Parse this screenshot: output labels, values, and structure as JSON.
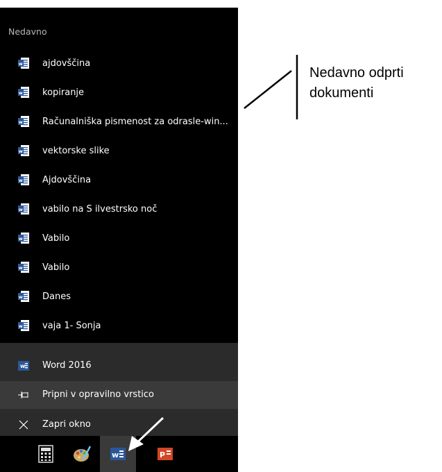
{
  "jumplist": {
    "section_title": "Nedavno",
    "recent": [
      "ajdovščina",
      "kopiranje",
      "Računalniška pismenost za odrasle-win...",
      "vektorske slike",
      "Ajdovščina",
      "vabilo na S ilvestrsko noč",
      "Vabilo",
      "Vabilo",
      "Danes",
      "vaja 1- Sonja"
    ],
    "tasks": {
      "app": "Word 2016",
      "pin": "Pripni v opravilno vrstico",
      "close": "Zapri okno"
    }
  },
  "taskbar": {
    "items": [
      "calculator-icon",
      "paint-icon",
      "word-icon",
      "powerpoint-icon"
    ]
  },
  "annotation": {
    "line1": "Nedavno odprti",
    "line2": "dokumenti"
  },
  "colors": {
    "word_blue": "#2b579a",
    "powerpoint_red": "#d24726",
    "tasks_bg": "#2b2b2b"
  }
}
